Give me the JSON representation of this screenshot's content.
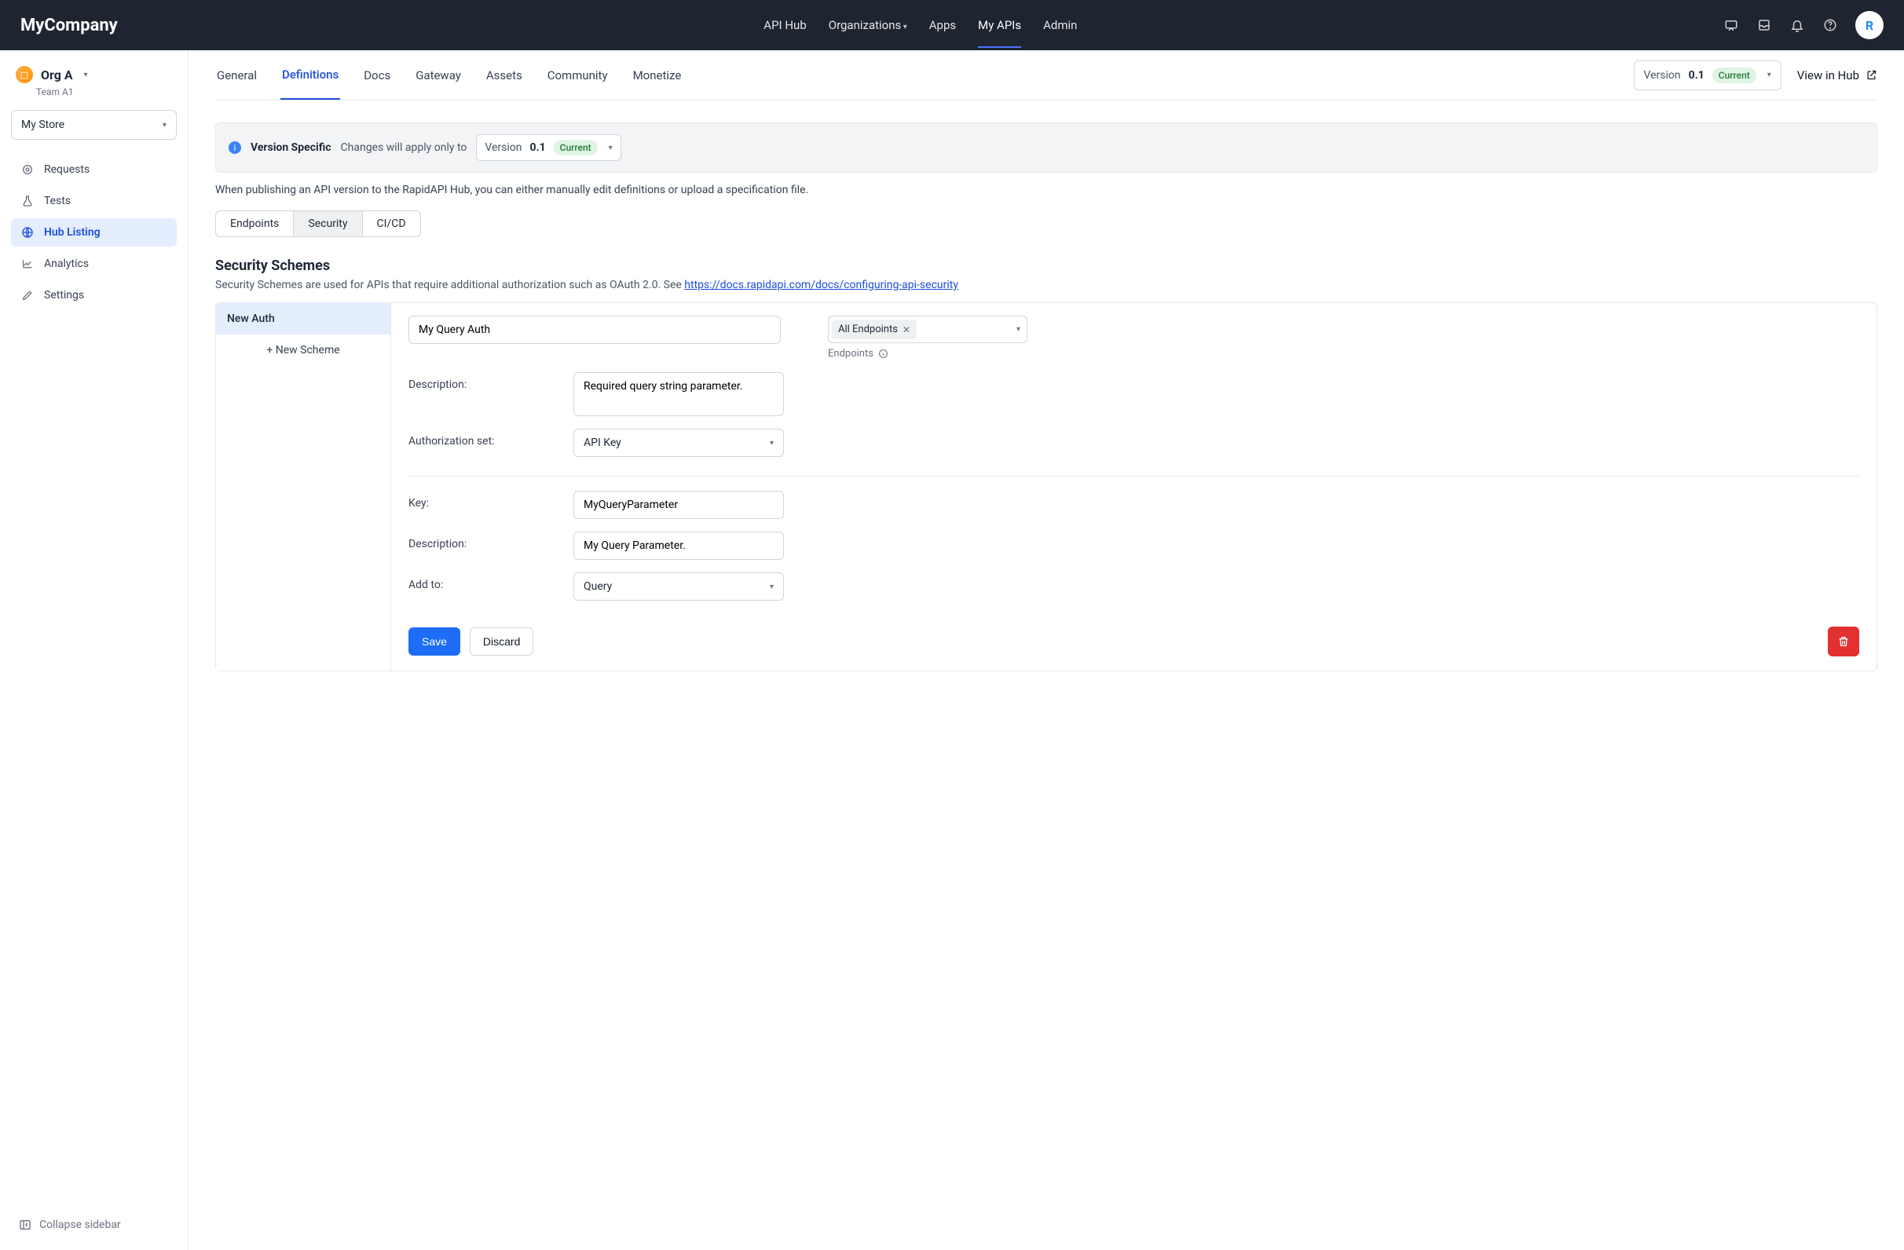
{
  "topbar": {
    "brand": "MyCompany",
    "nav": [
      "API Hub",
      "Organizations",
      "Apps",
      "My APIs",
      "Admin"
    ],
    "active_nav_index": 3,
    "avatar_letter": "R"
  },
  "sidebar": {
    "org_name": "Org A",
    "team_name": "Team A1",
    "store_name": "My Store",
    "items": [
      {
        "label": "Requests"
      },
      {
        "label": "Tests"
      },
      {
        "label": "Hub Listing"
      },
      {
        "label": "Analytics"
      },
      {
        "label": "Settings"
      }
    ],
    "active_index": 2,
    "collapse_label": "Collapse sidebar"
  },
  "tabs": {
    "items": [
      "General",
      "Definitions",
      "Docs",
      "Gateway",
      "Assets",
      "Community",
      "Monetize"
    ],
    "active_index": 1,
    "version_label": "Version",
    "version_value": "0.1",
    "version_pill": "Current",
    "view_in_hub": "View in Hub"
  },
  "notice": {
    "title": "Version Specific",
    "text": "Changes will apply only to",
    "version_label": "Version",
    "version_value": "0.1",
    "version_pill": "Current"
  },
  "publish_text": "When publishing an API version to the RapidAPI Hub, you can either manually edit definitions or upload a specification file.",
  "subtabs": {
    "items": [
      "Endpoints",
      "Security",
      "CI/CD"
    ],
    "active_index": 1
  },
  "section": {
    "title": "Security Schemes",
    "desc_prefix": "Security Schemes are used for APIs that require additional authorization such as OAuth 2.0. See ",
    "desc_link": "https://docs.rapidapi.com/docs/configuring-api-security"
  },
  "panel": {
    "scheme_name": "New Auth",
    "new_scheme_label": "+ New Scheme",
    "name_value": "My Query Auth",
    "endpoints_tag": "All Endpoints",
    "endpoints_meta": "Endpoints",
    "desc_label": "Description:",
    "desc_value": "Required query string parameter.",
    "auth_label": "Authorization set:",
    "auth_value": "API Key",
    "key_label": "Key:",
    "key_value": "MyQueryParameter",
    "key_desc_label": "Description:",
    "key_desc_value": "My Query Parameter.",
    "addto_label": "Add to:",
    "addto_value": "Query",
    "save_label": "Save",
    "discard_label": "Discard"
  }
}
